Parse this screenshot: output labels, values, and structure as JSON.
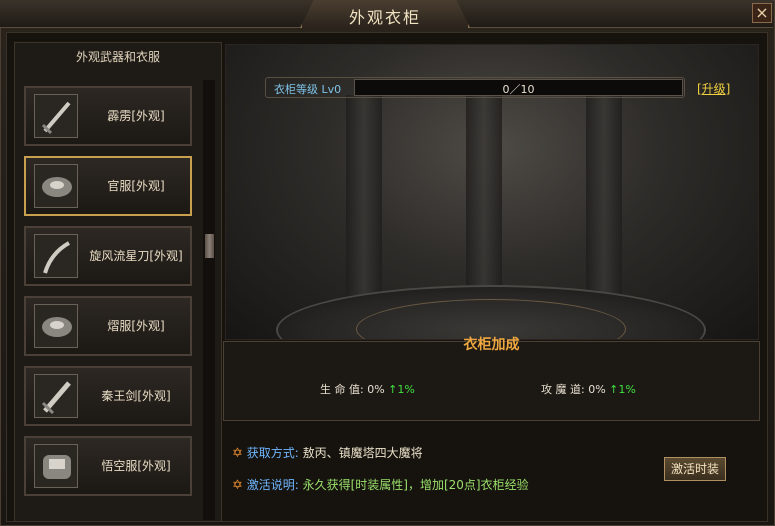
{
  "window": {
    "title": "外观衣柜",
    "close_label": "×"
  },
  "left": {
    "header": "外观武器和衣服",
    "items": [
      {
        "label": "霹雳[外观]",
        "icon": "sword-icon",
        "selected": false
      },
      {
        "label": "官服[外观]",
        "icon": "armor-icon",
        "selected": true
      },
      {
        "label": "旋风流星刀[外观]",
        "icon": "curved-blade-icon",
        "selected": false
      },
      {
        "label": "熠服[外观]",
        "icon": "armor-icon",
        "selected": false
      },
      {
        "label": "秦王剑[外观]",
        "icon": "sword-icon",
        "selected": false
      },
      {
        "label": "悟空服[外观]",
        "icon": "armor-icon",
        "selected": false
      }
    ]
  },
  "wardrobe": {
    "level_label": "衣柜等级",
    "level_value": "Lv0",
    "progress_text": "0／10",
    "progress_fraction": 0,
    "upgrade_label": "[升级]"
  },
  "bonus": {
    "title": "衣柜加成",
    "stats": [
      {
        "name": "生 命 值:",
        "value": "0%",
        "gain": "1%"
      },
      {
        "name": "攻 魔 道:",
        "value": "0%",
        "gain": "1%"
      }
    ]
  },
  "info": {
    "obtain_key": "获取方式:",
    "obtain_val": "敖丙、镇魔塔四大魔将",
    "activate_key": "激活说明:",
    "activate_val": "永久获得[时装属性]，增加[20点]衣柜经验"
  },
  "activate_button": "激活时装",
  "colors": {
    "accent": "#c8a050",
    "stat_up": "#40e040",
    "title_orange": "#f0a840",
    "link_yellow": "#f0d040"
  }
}
